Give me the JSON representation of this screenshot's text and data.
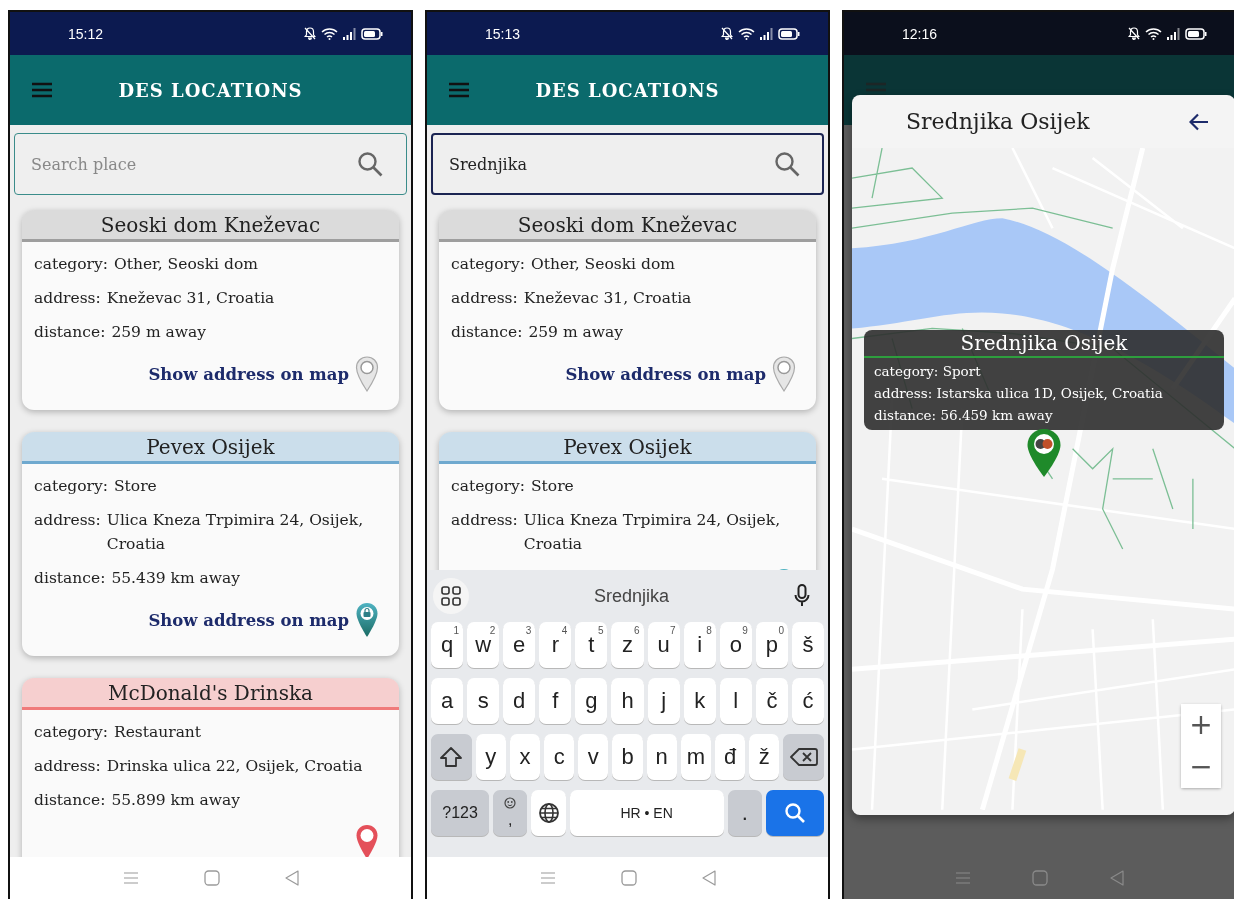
{
  "screens": [
    {
      "kind": "list",
      "status_bar": {
        "time": "15:12"
      },
      "app_bar": {
        "title": "DES LOCATIONS"
      },
      "search": {
        "placeholder": "Search place",
        "focused": false
      },
      "places": [
        {
          "title": "Seoski dom Kneževac",
          "color": "#9e9e9e",
          "fields": [
            {
              "label": "category:",
              "value": "Other, Seoski dom"
            },
            {
              "label": "address:",
              "value": "Kneževac 31, Croatia"
            },
            {
              "label": "distance:",
              "value": "259 m away"
            }
          ],
          "link": "Show address on map",
          "kind": "unknown"
        },
        {
          "title": "Pevex Osijek",
          "color": "#6fa9cf",
          "fields": [
            {
              "label": "category:",
              "value": "Store"
            },
            {
              "label": "address:",
              "value": "Ulica Kneza Trpimira 24, Osijek, Croatia"
            },
            {
              "label": "distance:",
              "value": "55.439 km away"
            }
          ],
          "link": "Show address on map",
          "kind": "store"
        },
        {
          "title": "McDonald's Drinska",
          "color": "#f07a7a",
          "fields": [
            {
              "label": "category:",
              "value": "Restaurant"
            },
            {
              "label": "address:",
              "value": "Drinska ulica 22, Osijek, Croatia"
            },
            {
              "label": "distance:",
              "value": "55.899 km away"
            }
          ],
          "kind": "restaurant"
        }
      ]
    },
    {
      "kind": "search",
      "status_bar": {
        "time": "15:13"
      },
      "app_bar": {
        "title": "DES LOCATIONS"
      },
      "search": {
        "value": "Srednjika",
        "focused": true
      },
      "places": [
        {
          "title": "Seoski dom Kneževac",
          "color": "#9e9e9e",
          "fields": [
            {
              "label": "category:",
              "value": "Other, Seoski dom"
            },
            {
              "label": "address:",
              "value": "Kneževac 31, Croatia"
            },
            {
              "label": "distance:",
              "value": "259 m away"
            }
          ],
          "link": "Show address on map",
          "kind": "unknown"
        },
        {
          "title": "Pevex Osijek",
          "color": "#6fa9cf",
          "fields": [
            {
              "label": "category:",
              "value": "Store"
            },
            {
              "label": "address:",
              "value": "Ulica Kneza Trpimira 24, Osijek, Croatia"
            }
          ],
          "kind": "store"
        }
      ],
      "keyboard": {
        "suggestion": "Srednjika",
        "rows": [
          [
            {
              "key": "q",
              "hint": "1"
            },
            {
              "key": "w",
              "hint": "2"
            },
            {
              "key": "e",
              "hint": "3"
            },
            {
              "key": "r",
              "hint": "4"
            },
            {
              "key": "t",
              "hint": "5"
            },
            {
              "key": "z",
              "hint": "6"
            },
            {
              "key": "u",
              "hint": "7"
            },
            {
              "key": "i",
              "hint": "8"
            },
            {
              "key": "o",
              "hint": "9"
            },
            {
              "key": "p",
              "hint": "0"
            },
            {
              "key": "š"
            }
          ],
          [
            {
              "key": "a"
            },
            {
              "key": "s"
            },
            {
              "key": "d"
            },
            {
              "key": "f"
            },
            {
              "key": "g"
            },
            {
              "key": "h"
            },
            {
              "key": "j"
            },
            {
              "key": "k"
            },
            {
              "key": "l"
            },
            {
              "key": "č"
            },
            {
              "key": "ć"
            }
          ],
          [
            {
              "kind": "shift"
            },
            {
              "key": "y"
            },
            {
              "key": "x"
            },
            {
              "key": "c"
            },
            {
              "key": "v"
            },
            {
              "key": "b"
            },
            {
              "key": "n"
            },
            {
              "key": "m"
            },
            {
              "key": "đ"
            },
            {
              "key": "ž"
            },
            {
              "kind": "backspace"
            }
          ]
        ],
        "symbols_key": "?123",
        "comma_key": ",",
        "space_key": "HR • EN",
        "period_key": "."
      }
    },
    {
      "kind": "map",
      "status_bar": {
        "time": "12:16"
      },
      "dialog": {
        "title": "Srednjika Osijek",
        "info": {
          "title": "Srednjika Osijek",
          "color": "#2e9e3e",
          "fields": [
            {
              "label": "category:",
              "value": "Sport"
            },
            {
              "label": "address:",
              "value": "Istarska ulica 1D, Osijek, Croatia"
            },
            {
              "label": "distance:",
              "value": "56.459 km away"
            }
          ]
        },
        "zoom_in": "+",
        "zoom_out": "−"
      }
    }
  ]
}
